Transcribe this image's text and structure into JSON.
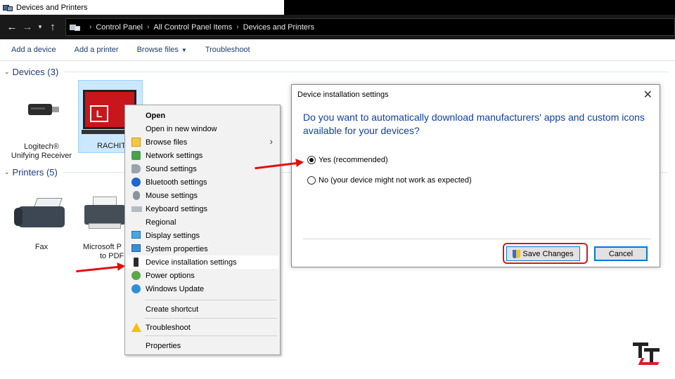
{
  "window": {
    "title": "Devices and Printers"
  },
  "breadcrumb": [
    "Control Panel",
    "All Control Panel Items",
    "Devices and Printers"
  ],
  "toolbar": {
    "add_device": "Add a device",
    "add_printer": "Add a printer",
    "browse_files": "Browse files",
    "troubleshoot": "Troubleshoot"
  },
  "groups": {
    "devices": {
      "label": "Devices (3)"
    },
    "printers": {
      "label": "Printers (5)"
    }
  },
  "devices": {
    "logitech": {
      "line1": "Logitech®",
      "line2": "Unifying Receiver"
    },
    "rachit": {
      "label": "RACHIT",
      "badge": "L"
    }
  },
  "printers": {
    "fax": {
      "label": "Fax"
    },
    "pdf": {
      "line1": "Microsoft P",
      "line2": "to PDF"
    }
  },
  "context_menu": {
    "items": [
      "Open",
      "Open in new window",
      "Browse files",
      "Network settings",
      "Sound settings",
      "Bluetooth settings",
      "Mouse settings",
      "Keyboard settings",
      "Regional",
      "Display settings",
      "System properties",
      "Device installation settings",
      "Power options",
      "Windows Update",
      "Create shortcut",
      "Troubleshoot",
      "Properties"
    ]
  },
  "dialog": {
    "title": "Device installation settings",
    "question": "Do you want to automatically download manufacturers' apps and custom icons available for your devices?",
    "option_yes": "Yes (recommended)",
    "option_no": "No (your device might not work as expected)",
    "save": "Save Changes",
    "cancel": "Cancel"
  },
  "colors": {
    "accent_link": "#1e3a78",
    "question_blue": "#0f3fa6",
    "highlight_red": "#e01010",
    "selection": "#cce8ff"
  }
}
